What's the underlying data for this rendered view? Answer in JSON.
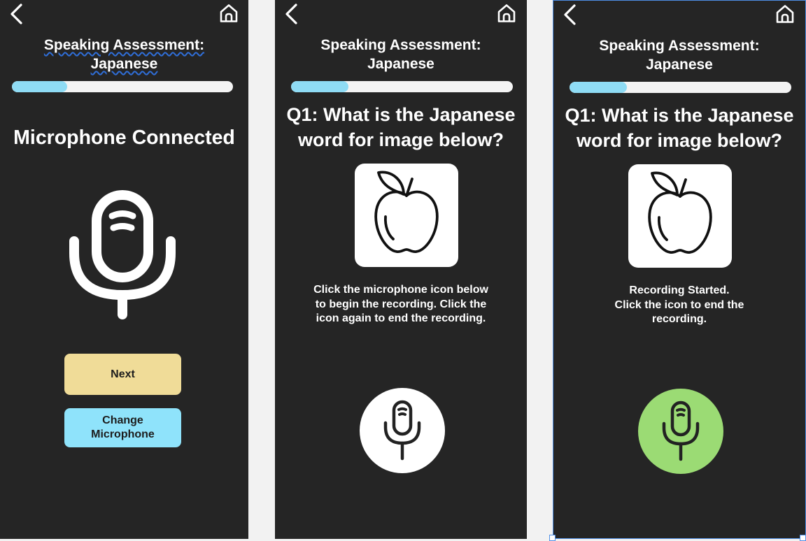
{
  "colors": {
    "screen_bg": "#252525",
    "progress_fill": "#8fdcf5",
    "next_button": "#f0dc98",
    "change_button": "#8fe3fb",
    "recording_green": "#9bdb74",
    "selection_blue": "#4f8fe6"
  },
  "icons": {
    "back": "chevron-left-icon",
    "home": "home-icon",
    "microphone": "microphone-icon",
    "image": "apple-icon"
  },
  "screens": [
    {
      "title_line1": "Speaking Assessment:",
      "title_line2": "Japanese",
      "progress": 0.25,
      "heading": "Microphone Connected",
      "next_label": "Next",
      "change_label_line1": "Change",
      "change_label_line2": "Microphone"
    },
    {
      "title_line1": "Speaking Assessment:",
      "title_line2": "Japanese",
      "progress": 0.26,
      "question_line1": "Q1: What is the Japanese",
      "question_line2": "word for image below?",
      "instruction_line1": "Click the microphone icon below",
      "instruction_line2": "to begin the recording. Click the",
      "instruction_line3": "icon again to end the recording.",
      "mic_state": "idle"
    },
    {
      "title_line1": "Speaking Assessment:",
      "title_line2": "Japanese",
      "progress": 0.26,
      "question_line1": "Q1: What is the Japanese",
      "question_line2": "word for image below?",
      "instruction_line1": "Recording Started.",
      "instruction_line2": "Click the icon to end the",
      "instruction_line3": "recording.",
      "mic_state": "recording"
    }
  ]
}
